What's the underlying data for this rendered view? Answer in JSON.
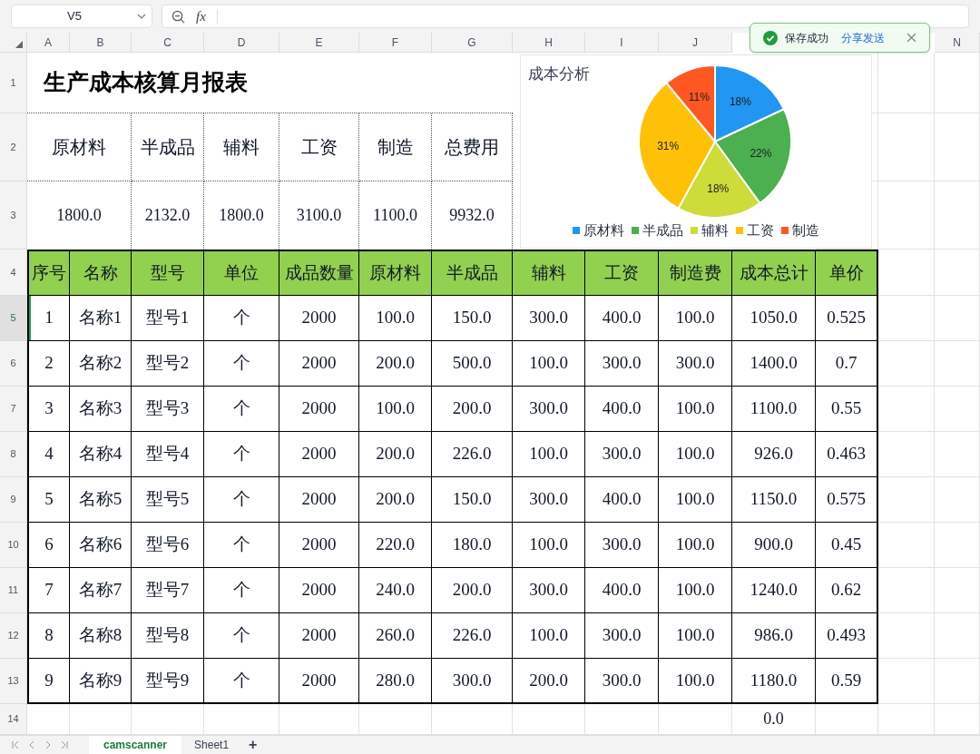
{
  "name_box": {
    "value": "V5"
  },
  "formula_bar": {
    "fx_label": "fx"
  },
  "column_headers": [
    "A",
    "B",
    "C",
    "D",
    "E",
    "F",
    "G",
    "H",
    "I",
    "J",
    "N"
  ],
  "row_headers": [
    {
      "label": "1",
      "selected": false
    },
    {
      "label": "2",
      "selected": false
    },
    {
      "label": "3",
      "selected": false
    },
    {
      "label": "4",
      "selected": false
    },
    {
      "label": "5",
      "selected": true
    },
    {
      "label": "6",
      "selected": false
    },
    {
      "label": "7",
      "selected": false
    },
    {
      "label": "8",
      "selected": false
    },
    {
      "label": "9",
      "selected": false
    },
    {
      "label": "10",
      "selected": false
    },
    {
      "label": "11",
      "selected": false
    },
    {
      "label": "12",
      "selected": false
    },
    {
      "label": "13",
      "selected": false
    },
    {
      "label": "14",
      "selected": false
    }
  ],
  "title": "生产成本核算月报表",
  "summary": {
    "labels": [
      "原材料",
      "半成品",
      "辅料",
      "工资",
      "制造",
      "总费用"
    ],
    "values": [
      "1800.0",
      "2132.0",
      "1800.0",
      "3100.0",
      "1100.0",
      "9932.0"
    ]
  },
  "table": {
    "columns": [
      "序号",
      "名称",
      "型号",
      "单位",
      "成品数量",
      "原材料",
      "半成品",
      "辅料",
      "工资",
      "制造费",
      "成本总计",
      "单价"
    ],
    "rows": [
      [
        "1",
        "名称1",
        "型号1",
        "个",
        "2000",
        "100.0",
        "150.0",
        "300.0",
        "400.0",
        "100.0",
        "1050.0",
        "0.525"
      ],
      [
        "2",
        "名称2",
        "型号2",
        "个",
        "2000",
        "200.0",
        "500.0",
        "100.0",
        "300.0",
        "300.0",
        "1400.0",
        "0.7"
      ],
      [
        "3",
        "名称3",
        "型号3",
        "个",
        "2000",
        "100.0",
        "200.0",
        "300.0",
        "400.0",
        "100.0",
        "1100.0",
        "0.55"
      ],
      [
        "4",
        "名称4",
        "型号4",
        "个",
        "2000",
        "200.0",
        "226.0",
        "100.0",
        "300.0",
        "100.0",
        "926.0",
        "0.463"
      ],
      [
        "5",
        "名称5",
        "型号5",
        "个",
        "2000",
        "200.0",
        "150.0",
        "300.0",
        "400.0",
        "100.0",
        "1150.0",
        "0.575"
      ],
      [
        "6",
        "名称6",
        "型号6",
        "个",
        "2000",
        "220.0",
        "180.0",
        "100.0",
        "300.0",
        "100.0",
        "900.0",
        "0.45"
      ],
      [
        "7",
        "名称7",
        "型号7",
        "个",
        "2000",
        "240.0",
        "200.0",
        "300.0",
        "400.0",
        "100.0",
        "1240.0",
        "0.62"
      ],
      [
        "8",
        "名称8",
        "型号8",
        "个",
        "2000",
        "260.0",
        "226.0",
        "100.0",
        "300.0",
        "100.0",
        "986.0",
        "0.493"
      ],
      [
        "9",
        "名称9",
        "型号9",
        "个",
        "2000",
        "280.0",
        "300.0",
        "200.0",
        "300.0",
        "100.0",
        "1180.0",
        "0.59"
      ]
    ]
  },
  "total_below": "0.0",
  "chart": {
    "chart_data": {
      "type": "pie",
      "title": "成本分析",
      "categories": [
        "原材料",
        "半成品",
        "辅料",
        "工资",
        "制造"
      ],
      "series": [
        {
          "values": [
            18,
            22,
            18,
            31,
            11
          ]
        }
      ],
      "legend": "bottom",
      "colors": [
        "#2196f3",
        "#4caf50",
        "#cddc39",
        "#ffc107",
        "#ff5722"
      ],
      "value_labels": [
        "18%",
        "22%",
        "18%",
        "31%",
        "11%"
      ]
    }
  },
  "toast": {
    "message": "保存成功",
    "link": "分享发送"
  },
  "sheet_tabs": [
    {
      "label": "camscanner",
      "selected": true
    },
    {
      "label": "Sheet1",
      "selected": false
    }
  ],
  "add_sheet": "+"
}
